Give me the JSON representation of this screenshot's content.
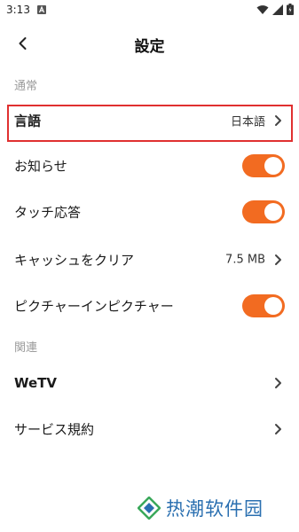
{
  "status_bar": {
    "time": "3:13",
    "icons": [
      "notification-a-icon",
      "wifi-icon",
      "signal-icon",
      "battery-icon"
    ]
  },
  "header": {
    "title": "設定",
    "back_icon": "chevron-left-icon"
  },
  "sections": {
    "general_label": "通常",
    "related_label": "関連"
  },
  "rows": {
    "language": {
      "label": "言語",
      "value": "日本語"
    },
    "notifications": {
      "label": "お知らせ",
      "toggle_on": true
    },
    "touch_feedback": {
      "label": "タッチ応答",
      "toggle_on": true
    },
    "clear_cache": {
      "label": "キャッシュをクリア",
      "value": "7.5 MB"
    },
    "picture_in_picture": {
      "label": "ピクチャーインピクチャー",
      "toggle_on": true
    },
    "wetv": {
      "label": "WeTV"
    },
    "terms": {
      "label": "サービス規約"
    }
  },
  "watermark": {
    "text": "热潮软件园"
  },
  "colors": {
    "accent": "#f26b21",
    "highlight_border": "#e03030",
    "section_label": "#9b9b9b",
    "watermark": "#2a6fb0"
  }
}
